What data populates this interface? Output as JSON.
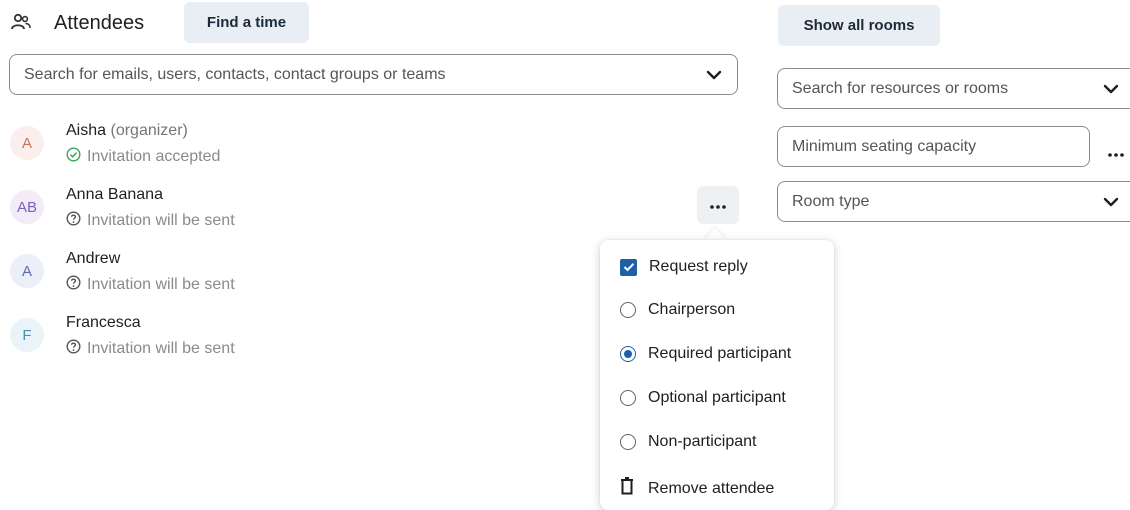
{
  "attendees_header": {
    "title": "Attendees",
    "find_time_label": "Find a time"
  },
  "search": {
    "placeholder": "Search for emails, users, contacts, contact groups or teams"
  },
  "attendees": [
    {
      "initials": "A",
      "name": "Aisha",
      "role": "(organizer)",
      "status": "Invitation accepted",
      "status_icon": "check-circle-icon",
      "avatar_bg": "#fbefed",
      "avatar_fg": "#c9705f"
    },
    {
      "initials": "AB",
      "name": "Anna Banana",
      "role": "",
      "status": "Invitation will be sent",
      "status_icon": "question-circle-icon",
      "avatar_bg": "#f1ecf8",
      "avatar_fg": "#7d5fb8"
    },
    {
      "initials": "A",
      "name": "Andrew",
      "role": "",
      "status": "Invitation will be sent",
      "status_icon": "question-circle-icon",
      "avatar_bg": "#eceff8",
      "avatar_fg": "#5a6bb0"
    },
    {
      "initials": "F",
      "name": "Francesca",
      "role": "",
      "status": "Invitation will be sent",
      "status_icon": "question-circle-icon",
      "avatar_bg": "#e9f3f8",
      "avatar_fg": "#4a8fb5"
    }
  ],
  "rooms": {
    "show_all_label": "Show all rooms",
    "search_placeholder": "Search for resources or rooms",
    "capacity_placeholder": "Minimum seating capacity",
    "room_type_placeholder": "Room type"
  },
  "attendee_menu": {
    "request_reply": "Request reply",
    "request_reply_checked": true,
    "options": [
      {
        "label": "Chairperson",
        "selected": false
      },
      {
        "label": "Required participant",
        "selected": true
      },
      {
        "label": "Optional participant",
        "selected": false
      },
      {
        "label": "Non-participant",
        "selected": false
      }
    ],
    "remove_label": "Remove attendee"
  },
  "colors": {
    "accent": "#1f5fa8",
    "pill_bg": "#e8eef4",
    "accepted_green": "#3aa655"
  }
}
